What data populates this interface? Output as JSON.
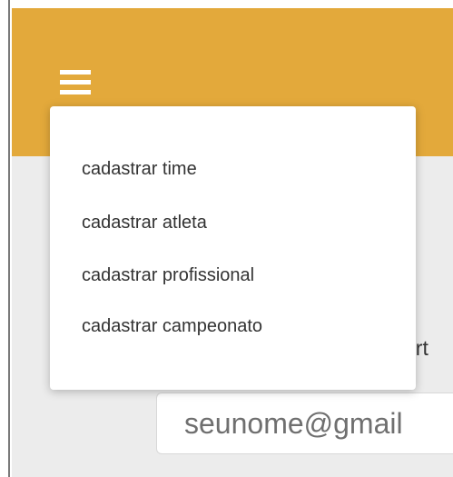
{
  "colors": {
    "app_bar": "#e3a93b",
    "background": "#ececec",
    "menu_surface": "#ffffff",
    "text": "#333333"
  },
  "header": {
    "menu_icon": "hamburger-menu-icon"
  },
  "menu": {
    "items": [
      {
        "label": "cadastrar time"
      },
      {
        "label": "cadastrar atleta"
      },
      {
        "label": "cadastrar profissional"
      },
      {
        "label": "cadastrar campeonato"
      }
    ]
  },
  "form": {
    "label_fragment": "ort",
    "email_placeholder": "seunome@gmail"
  }
}
